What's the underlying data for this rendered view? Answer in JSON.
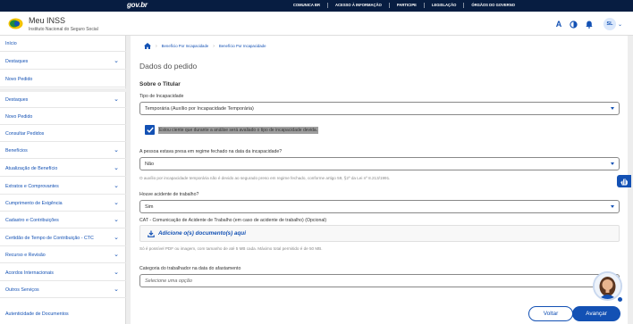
{
  "govbar": {
    "logo": "gov.br",
    "links": [
      "COMUNICA BR",
      "ACESSO À INFORMAÇÃO",
      "PARTICIPE",
      "LEGISLAÇÃO",
      "ÓRGÃOS DO GOVERNO"
    ]
  },
  "header": {
    "title": "Meu INSS",
    "subtitle": "Instituto Nacional do Seguro Social",
    "font_icon_label": "A",
    "avatar_initials": "SL"
  },
  "sidebar": {
    "items": [
      {
        "label": "Início",
        "chevron": false
      },
      {
        "label": "Destaques",
        "chevron": true
      },
      {
        "label": "Novo Pedido",
        "chevron": false
      },
      {
        "label": "Destaques",
        "chevron": true
      },
      {
        "label": "Novo Pedido",
        "chevron": false
      },
      {
        "label": "Consultar Pedidos",
        "chevron": false
      },
      {
        "label": "Benefícios",
        "chevron": true
      },
      {
        "label": "Atualização de Benefício",
        "chevron": true
      },
      {
        "label": "Extratos e Comprovantes",
        "chevron": true
      },
      {
        "label": "Cumprimento de Exigência",
        "chevron": true
      },
      {
        "label": "Cadastro e Contribuições",
        "chevron": true
      },
      {
        "label": "Certidão de Tempo de Contribuição - CTC",
        "chevron": true
      },
      {
        "label": "Recurso e Revisão",
        "chevron": true
      },
      {
        "label": "Acordos Internacionais",
        "chevron": true
      },
      {
        "label": "Outros Serviços",
        "chevron": true
      },
      {
        "label": "Autenticidade de Documentos",
        "chevron": false
      }
    ]
  },
  "breadcrumb": [
    "Benefício Por Incapacidade",
    "Benefício Por Incapacidade"
  ],
  "form": {
    "page_title": "Dados do pedido",
    "section_title": "Sobre o Titular",
    "tipo_label": "Tipo de Incapacidade",
    "tipo_value": "Temporária (Auxílio por Incapacidade Temporária)",
    "checkbox_label": "Estou ciente que durante a análise será avaliado o tipo de incapacidade devida.",
    "checkbox_checked": true,
    "presa_label": "A pessoa estava presa em regime fechado na data da incapacidade?",
    "presa_value": "Não",
    "presa_hint": "O auxílio por incapacidade temporária não é devido ao segurado preso em regime fechado, conforme artigo 59, §2º da Lei nº 8.213/1991.",
    "acidente_label": "Houve acidente de trabalho?",
    "acidente_value": "Sim",
    "cat_label": "CAT - Comunicação de Acidente de Trabalho (em caso de acidente de trabalho) (Opcional)",
    "upload_label": "Adicione o(s) documento(s) aqui",
    "upload_hint": "Só é possível PDF ou imagem, com tamanho de até 5 MB cada. Máximo total permitido é de 50 MB.",
    "categoria_label": "Categoria do trabalhador na data do afastamento",
    "categoria_placeholder": "Selecione uma opção"
  },
  "actions": {
    "back_label": "Voltar",
    "next_label": "Avançar"
  },
  "colors": {
    "primary": "#1351b4",
    "govbar": "#071d41"
  }
}
